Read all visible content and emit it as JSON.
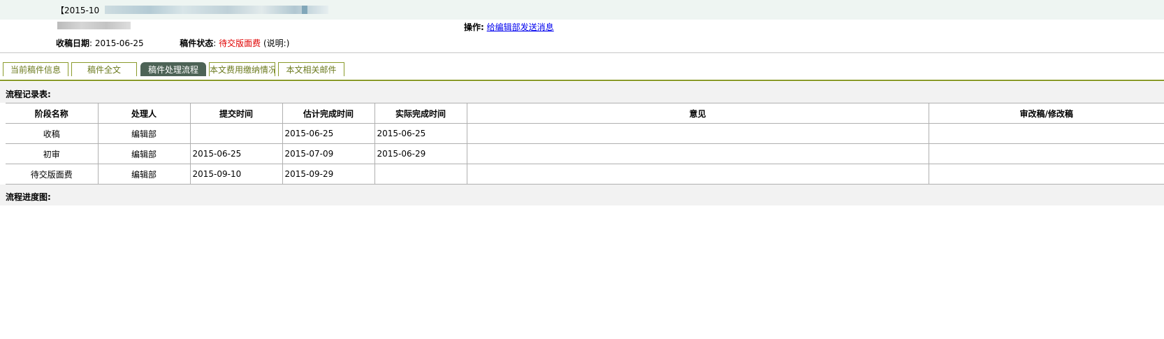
{
  "header": {
    "manuscript_title": "【2015-10",
    "ops_label": "操作",
    "ops_link": "给编辑部发送消息",
    "receive_date_label": "收稿日期",
    "receive_date": "2015-06-25",
    "status_label": "稿件状态",
    "status_value": "待交版面费",
    "note": "(说明:)"
  },
  "tabs": [
    {
      "label": "当前稿件信息",
      "active": false
    },
    {
      "label": "稿件全文",
      "active": false
    },
    {
      "label": "稿件处理流程",
      "active": true
    },
    {
      "label": "本文费用缴纳情况",
      "active": false
    },
    {
      "label": "本文相关邮件",
      "active": false
    }
  ],
  "flow_record": {
    "title": "流程记录表:",
    "columns": [
      "阶段名称",
      "处理人",
      "提交时间",
      "估计完成时间",
      "实际完成时间",
      "意见",
      "审改稿/修改稿"
    ],
    "rows": [
      [
        "收稿",
        "编辑部",
        "",
        "2015-06-25",
        "2015-06-25",
        "",
        ""
      ],
      [
        "初审",
        "编辑部",
        "2015-06-25",
        "2015-07-09",
        "2015-06-29",
        "",
        ""
      ],
      [
        "待交版面费",
        "编辑部",
        "2015-09-10",
        "2015-09-29",
        "",
        "",
        ""
      ]
    ]
  },
  "flow_progress": {
    "title": "流程进度图:"
  },
  "colors": {
    "status_red": "#e00000",
    "tab_active_bg": "#4d6356",
    "tab_border": "#8a9a2a",
    "link_blue": "#0000ee"
  }
}
